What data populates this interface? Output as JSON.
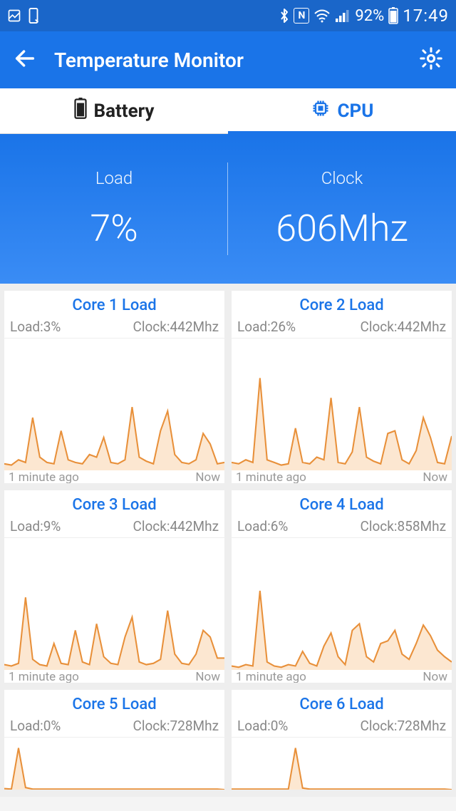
{
  "status": {
    "battery_pct": "92%",
    "time": "17:49"
  },
  "header": {
    "title": "Temperature Monitor"
  },
  "tabs": {
    "battery": "Battery",
    "cpu": "CPU"
  },
  "summary": {
    "load_label": "Load",
    "load_value": "7%",
    "clock_label": "Clock",
    "clock_value": "606Mhz"
  },
  "time_axis": {
    "start": "1 minute ago",
    "end": "Now"
  },
  "cores": [
    {
      "title": "Core 1 Load",
      "load_label": "Load:3%",
      "clock_label": "Clock:442Mhz"
    },
    {
      "title": "Core 2 Load",
      "load_label": "Load:26%",
      "clock_label": "Clock:442Mhz"
    },
    {
      "title": "Core 3 Load",
      "load_label": "Load:9%",
      "clock_label": "Clock:442Mhz"
    },
    {
      "title": "Core 4 Load",
      "load_label": "Load:6%",
      "clock_label": "Clock:858Mhz"
    },
    {
      "title": "Core 5 Load",
      "load_label": "Load:0%",
      "clock_label": "Clock:728Mhz"
    },
    {
      "title": "Core 6 Load",
      "load_label": "Load:0%",
      "clock_label": "Clock:728Mhz"
    }
  ],
  "chart_data": [
    {
      "type": "area",
      "title": "Core 1 Load",
      "xlabel": "",
      "ylabel": "Load",
      "ylim": [
        0,
        100
      ],
      "x_range": [
        "1 minute ago",
        "Now"
      ],
      "values": [
        5,
        4,
        8,
        6,
        40,
        10,
        6,
        5,
        30,
        8,
        6,
        5,
        12,
        10,
        25,
        6,
        5,
        8,
        48,
        10,
        7,
        5,
        30,
        45,
        12,
        6,
        5,
        8,
        28,
        20,
        5,
        6
      ]
    },
    {
      "type": "area",
      "title": "Core 2 Load",
      "xlabel": "",
      "ylabel": "Load",
      "ylim": [
        0,
        100
      ],
      "x_range": [
        "1 minute ago",
        "Now"
      ],
      "values": [
        6,
        5,
        8,
        6,
        70,
        8,
        6,
        4,
        5,
        32,
        6,
        5,
        10,
        8,
        55,
        6,
        5,
        14,
        48,
        10,
        7,
        5,
        28,
        30,
        8,
        5,
        15,
        40,
        25,
        6,
        5,
        26
      ]
    },
    {
      "type": "area",
      "title": "Core 3 Load",
      "xlabel": "",
      "ylabel": "Load",
      "ylim": [
        0,
        100
      ],
      "x_range": [
        "1 minute ago",
        "Now"
      ],
      "values": [
        4,
        3,
        5,
        55,
        8,
        4,
        3,
        20,
        5,
        4,
        30,
        6,
        4,
        35,
        10,
        5,
        4,
        25,
        40,
        6,
        4,
        5,
        8,
        45,
        12,
        5,
        4,
        12,
        30,
        25,
        9,
        9
      ]
    },
    {
      "type": "area",
      "title": "Core 4 Load",
      "xlabel": "",
      "ylabel": "Load",
      "ylim": [
        0,
        100
      ],
      "x_range": [
        "1 minute ago",
        "Now"
      ],
      "values": [
        3,
        2,
        4,
        3,
        60,
        6,
        3,
        2,
        4,
        3,
        14,
        5,
        3,
        18,
        28,
        10,
        4,
        30,
        35,
        10,
        6,
        20,
        22,
        30,
        12,
        8,
        20,
        34,
        26,
        15,
        10,
        6
      ]
    },
    {
      "type": "area",
      "title": "Core 5 Load",
      "xlabel": "",
      "ylabel": "Load",
      "ylim": [
        0,
        100
      ],
      "x_range": [
        "1 minute ago",
        "Now"
      ],
      "values": [
        2,
        1,
        80,
        4,
        1,
        1,
        1,
        1,
        1,
        1,
        1,
        1,
        1,
        1,
        1,
        1,
        1,
        1,
        1,
        1,
        1,
        1,
        1,
        1,
        1,
        1,
        1,
        1,
        1,
        1,
        1,
        0
      ]
    },
    {
      "type": "area",
      "title": "Core 6 Load",
      "xlabel": "",
      "ylabel": "Load",
      "ylim": [
        0,
        100
      ],
      "x_range": [
        "1 minute ago",
        "Now"
      ],
      "values": [
        1,
        1,
        1,
        1,
        1,
        1,
        1,
        1,
        1,
        80,
        3,
        1,
        1,
        1,
        1,
        1,
        1,
        1,
        1,
        1,
        1,
        1,
        1,
        1,
        1,
        1,
        1,
        1,
        1,
        1,
        1,
        0
      ]
    }
  ]
}
